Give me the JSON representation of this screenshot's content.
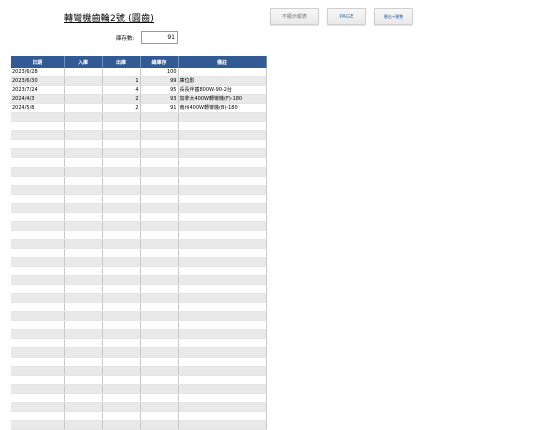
{
  "title": "轉彎機齒輪2號 (圓齒)",
  "buttons": {
    "print_stock": "不顯示報表",
    "page": "PAGE",
    "export": "匯出+匯整"
  },
  "stock": {
    "label": "庫存數:",
    "value": "91"
  },
  "table": {
    "headers": [
      "日期",
      "入庫",
      "出庫",
      "總庫存",
      "備註"
    ],
    "rows": [
      {
        "date": "2023/6/28",
        "in": "",
        "out": "",
        "total": "100",
        "note": ""
      },
      {
        "date": "2023/6/30",
        "in": "",
        "out": "1",
        "total": "99",
        "note": "庫位影"
      },
      {
        "date": "2023/7/24",
        "in": "",
        "out": "4",
        "total": "95",
        "note": "長長伴齒800W-90-2台"
      },
      {
        "date": "2024/4/3",
        "in": "",
        "out": "2",
        "total": "93",
        "note": "加拿大400W轉彎機(F)-180"
      },
      {
        "date": "2024/5/8",
        "in": "",
        "out": "2",
        "total": "91",
        "note": "南州400W轉彎機(B)-180"
      },
      {
        "date": "",
        "in": "",
        "out": "",
        "total": "",
        "note": ""
      },
      {
        "date": "",
        "in": "",
        "out": "",
        "total": "",
        "note": ""
      },
      {
        "date": "",
        "in": "",
        "out": "",
        "total": "",
        "note": ""
      },
      {
        "date": "",
        "in": "",
        "out": "",
        "total": "",
        "note": ""
      },
      {
        "date": "",
        "in": "",
        "out": "",
        "total": "",
        "note": ""
      },
      {
        "date": "",
        "in": "",
        "out": "",
        "total": "",
        "note": ""
      },
      {
        "date": "",
        "in": "",
        "out": "",
        "total": "",
        "note": ""
      },
      {
        "date": "",
        "in": "",
        "out": "",
        "total": "",
        "note": ""
      },
      {
        "date": "",
        "in": "",
        "out": "",
        "total": "",
        "note": ""
      },
      {
        "date": "",
        "in": "",
        "out": "",
        "total": "",
        "note": ""
      },
      {
        "date": "",
        "in": "",
        "out": "",
        "total": "",
        "note": ""
      },
      {
        "date": "",
        "in": "",
        "out": "",
        "total": "",
        "note": ""
      },
      {
        "date": "",
        "in": "",
        "out": "",
        "total": "",
        "note": ""
      },
      {
        "date": "",
        "in": "",
        "out": "",
        "total": "",
        "note": ""
      },
      {
        "date": "",
        "in": "",
        "out": "",
        "total": "",
        "note": ""
      },
      {
        "date": "",
        "in": "",
        "out": "",
        "total": "",
        "note": ""
      },
      {
        "date": "",
        "in": "",
        "out": "",
        "total": "",
        "note": ""
      },
      {
        "date": "",
        "in": "",
        "out": "",
        "total": "",
        "note": ""
      },
      {
        "date": "",
        "in": "",
        "out": "",
        "total": "",
        "note": ""
      },
      {
        "date": "",
        "in": "",
        "out": "",
        "total": "",
        "note": ""
      },
      {
        "date": "",
        "in": "",
        "out": "",
        "total": "",
        "note": ""
      },
      {
        "date": "",
        "in": "",
        "out": "",
        "total": "",
        "note": ""
      },
      {
        "date": "",
        "in": "",
        "out": "",
        "total": "",
        "note": ""
      },
      {
        "date": "",
        "in": "",
        "out": "",
        "total": "",
        "note": ""
      },
      {
        "date": "",
        "in": "",
        "out": "",
        "total": "",
        "note": ""
      },
      {
        "date": "",
        "in": "",
        "out": "",
        "total": "",
        "note": ""
      },
      {
        "date": "",
        "in": "",
        "out": "",
        "total": "",
        "note": ""
      },
      {
        "date": "",
        "in": "",
        "out": "",
        "total": "",
        "note": ""
      },
      {
        "date": "",
        "in": "",
        "out": "",
        "total": "",
        "note": ""
      },
      {
        "date": "",
        "in": "",
        "out": "",
        "total": "",
        "note": ""
      },
      {
        "date": "",
        "in": "",
        "out": "",
        "total": "",
        "note": ""
      },
      {
        "date": "",
        "in": "",
        "out": "",
        "total": "",
        "note": ""
      },
      {
        "date": "",
        "in": "",
        "out": "",
        "total": "",
        "note": ""
      },
      {
        "date": "",
        "in": "",
        "out": "",
        "total": "",
        "note": ""
      },
      {
        "date": "",
        "in": "",
        "out": "",
        "total": "",
        "note": ""
      }
    ]
  }
}
